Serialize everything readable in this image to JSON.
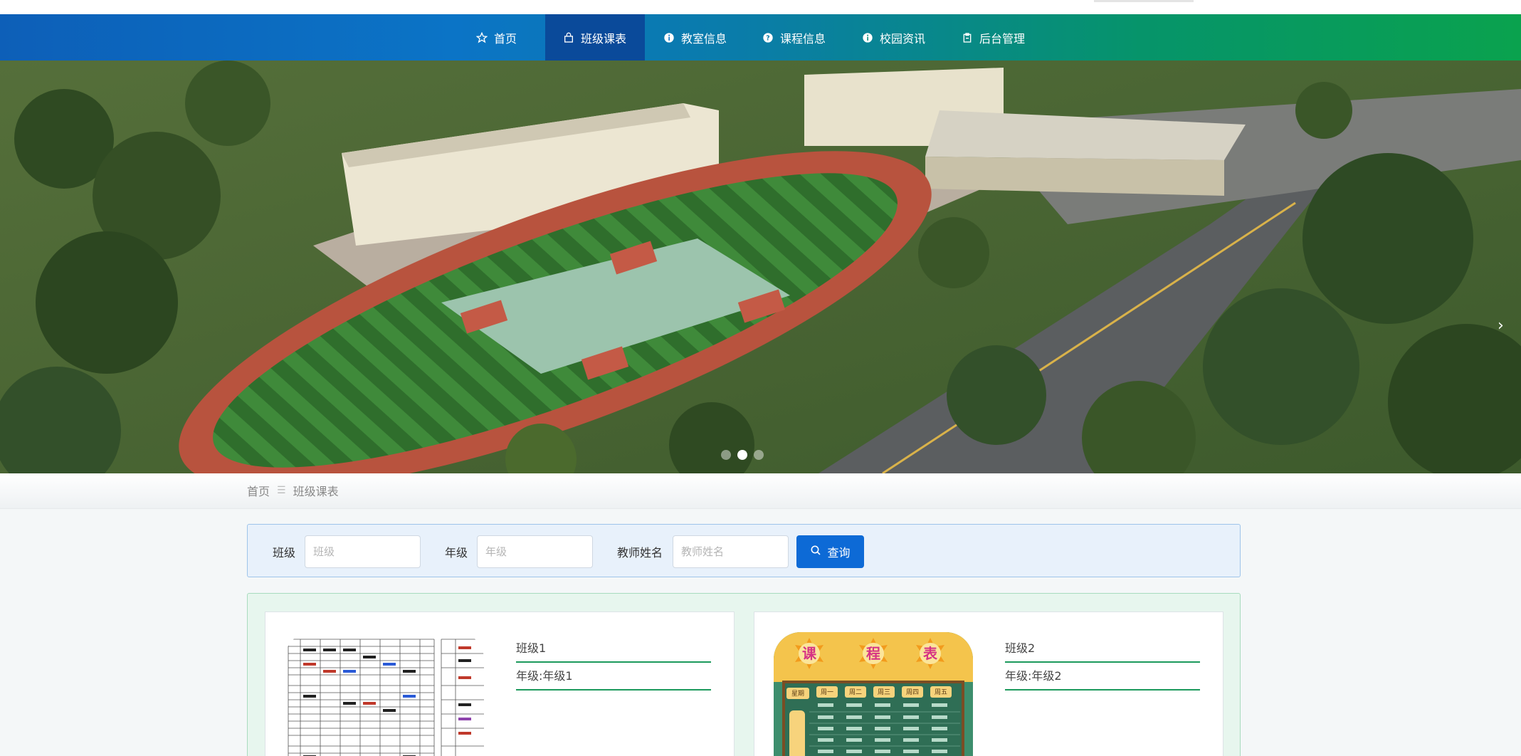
{
  "nav": {
    "items": [
      {
        "label": "首页",
        "icon": "star-icon"
      },
      {
        "label": "班级课表",
        "icon": "bag-icon",
        "active": true
      },
      {
        "label": "教室信息",
        "icon": "info-icon"
      },
      {
        "label": "课程信息",
        "icon": "question-icon"
      },
      {
        "label": "校园资讯",
        "icon": "info-icon"
      },
      {
        "label": "后台管理",
        "icon": "clipboard-icon"
      }
    ],
    "active_color": "#0a4a9a"
  },
  "carousel": {
    "slide_count": 3,
    "active_index": 1
  },
  "breadcrumb": {
    "home": "首页",
    "separator": "☰",
    "current": "班级课表"
  },
  "search": {
    "class_label": "班级",
    "class_placeholder": "班级",
    "grade_label": "年级",
    "grade_placeholder": "年级",
    "teacher_label": "教师姓名",
    "teacher_placeholder": "教师姓名",
    "button_label": "查询",
    "button_color": "#0d6ad6"
  },
  "cards": [
    {
      "title": "班级1",
      "grade": "年级:年级1",
      "image": "timetable-table-image"
    },
    {
      "title": "班级2",
      "grade": "年级:年级2",
      "image": "timetable-poster-image"
    }
  ],
  "poster": {
    "chars": [
      "课",
      "程",
      "表"
    ],
    "days": [
      "星期",
      "周一",
      "周二",
      "周三",
      "周四",
      "周五"
    ]
  },
  "colors": {
    "accent_green": "#1c9a5c",
    "nav_start": "#0d5fb8",
    "nav_end": "#0aa24e"
  }
}
